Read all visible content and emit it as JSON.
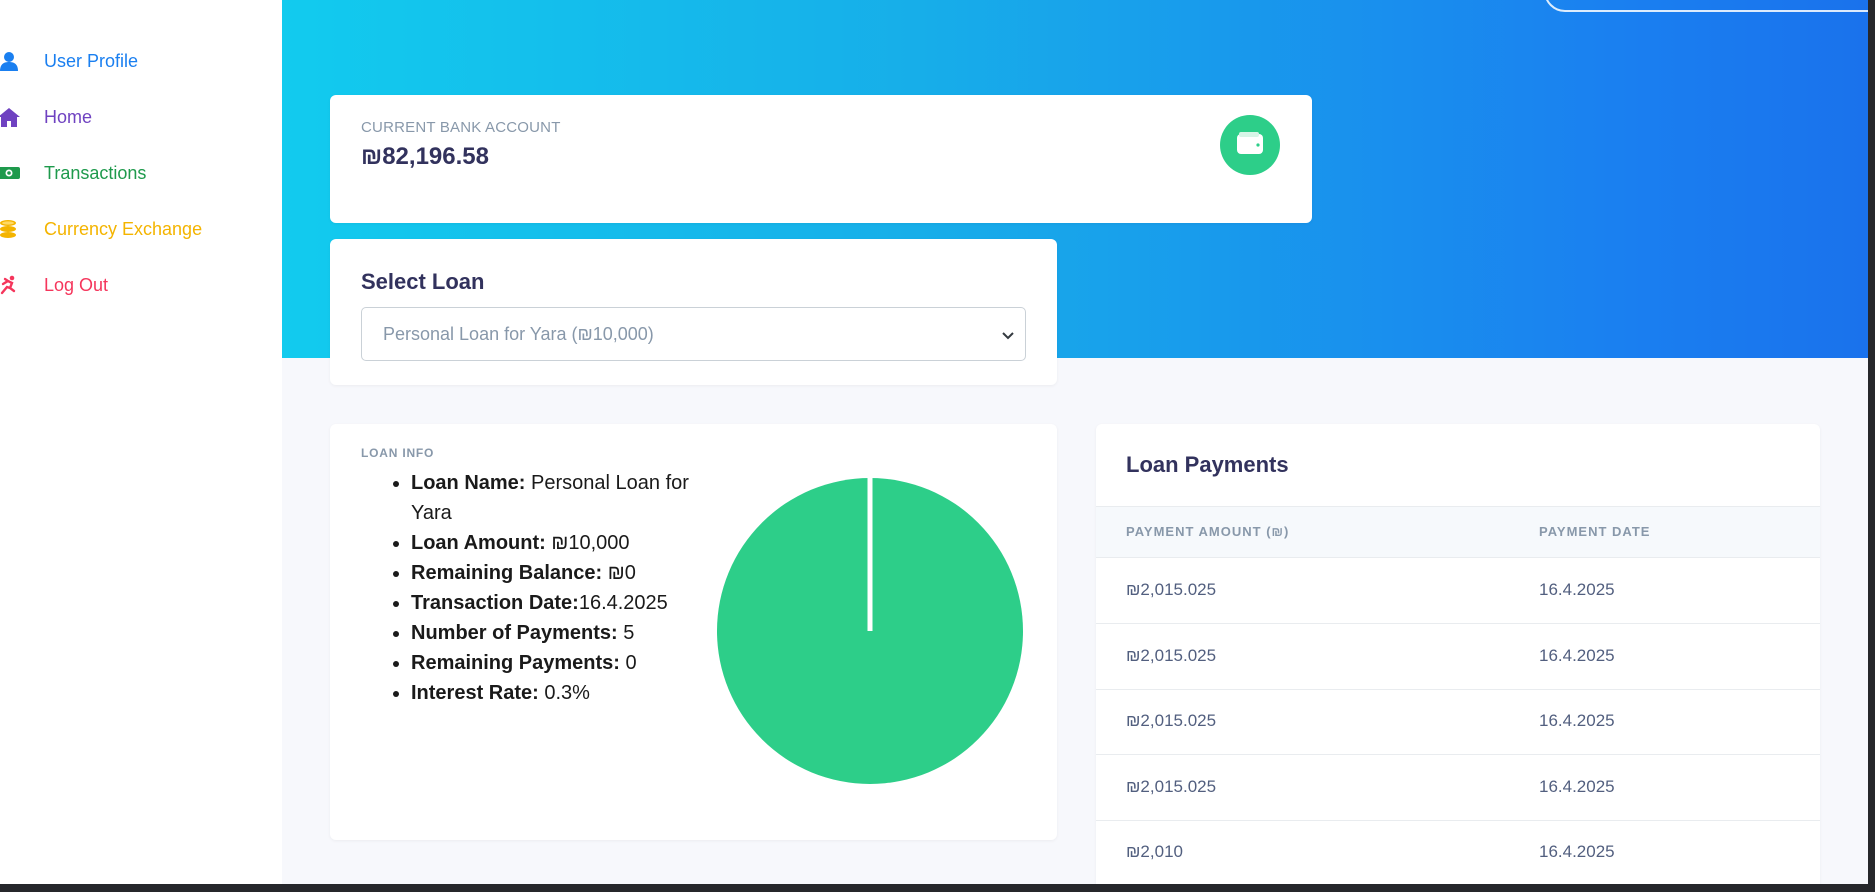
{
  "sidebar": {
    "items": [
      {
        "label": "User Profile",
        "icon": "user-icon",
        "color": "#1a7ff0"
      },
      {
        "label": "Home",
        "icon": "home-icon",
        "color": "#6f42c1"
      },
      {
        "label": "Transactions",
        "icon": "money-icon",
        "color": "#1e9a4c"
      },
      {
        "label": "Currency Exchange",
        "icon": "coins-icon",
        "color": "#f4b400"
      },
      {
        "label": "Log Out",
        "icon": "running-icon",
        "color": "#f5365c"
      }
    ]
  },
  "bank": {
    "label": "CURRENT BANK ACCOUNT",
    "amount": "₪82,196.58",
    "icon": "wallet-icon",
    "accent": "#2dce89"
  },
  "select_loan": {
    "title": "Select Loan",
    "selected": "Personal Loan for Yara (₪10,000)"
  },
  "loan_info": {
    "title": "LOAN INFO",
    "fields": [
      {
        "label": "Loan Name:",
        "value": " Personal Loan for Yara"
      },
      {
        "label": "Loan Amount:",
        "value": " ₪10,000"
      },
      {
        "label": "Remaining Balance:",
        "value": " ₪0"
      },
      {
        "label": "Transaction Date:",
        "value": "16.4.2025"
      },
      {
        "label": "Number of Payments:",
        "value": " 5"
      },
      {
        "label": "Remaining Payments:",
        "value": " 0"
      },
      {
        "label": "Interest Rate:",
        "value": " 0.3%"
      }
    ]
  },
  "chart_data": {
    "type": "pie",
    "values": [
      100
    ],
    "colors": [
      "#2dce89"
    ]
  },
  "payments": {
    "title": "Loan Payments",
    "columns": [
      "PAYMENT AMOUNT (₪)",
      "PAYMENT DATE"
    ],
    "rows": [
      [
        "₪2,015.025",
        "16.4.2025"
      ],
      [
        "₪2,015.025",
        "16.4.2025"
      ],
      [
        "₪2,015.025",
        "16.4.2025"
      ],
      [
        "₪2,015.025",
        "16.4.2025"
      ],
      [
        "₪2,010",
        "16.4.2025"
      ]
    ]
  }
}
